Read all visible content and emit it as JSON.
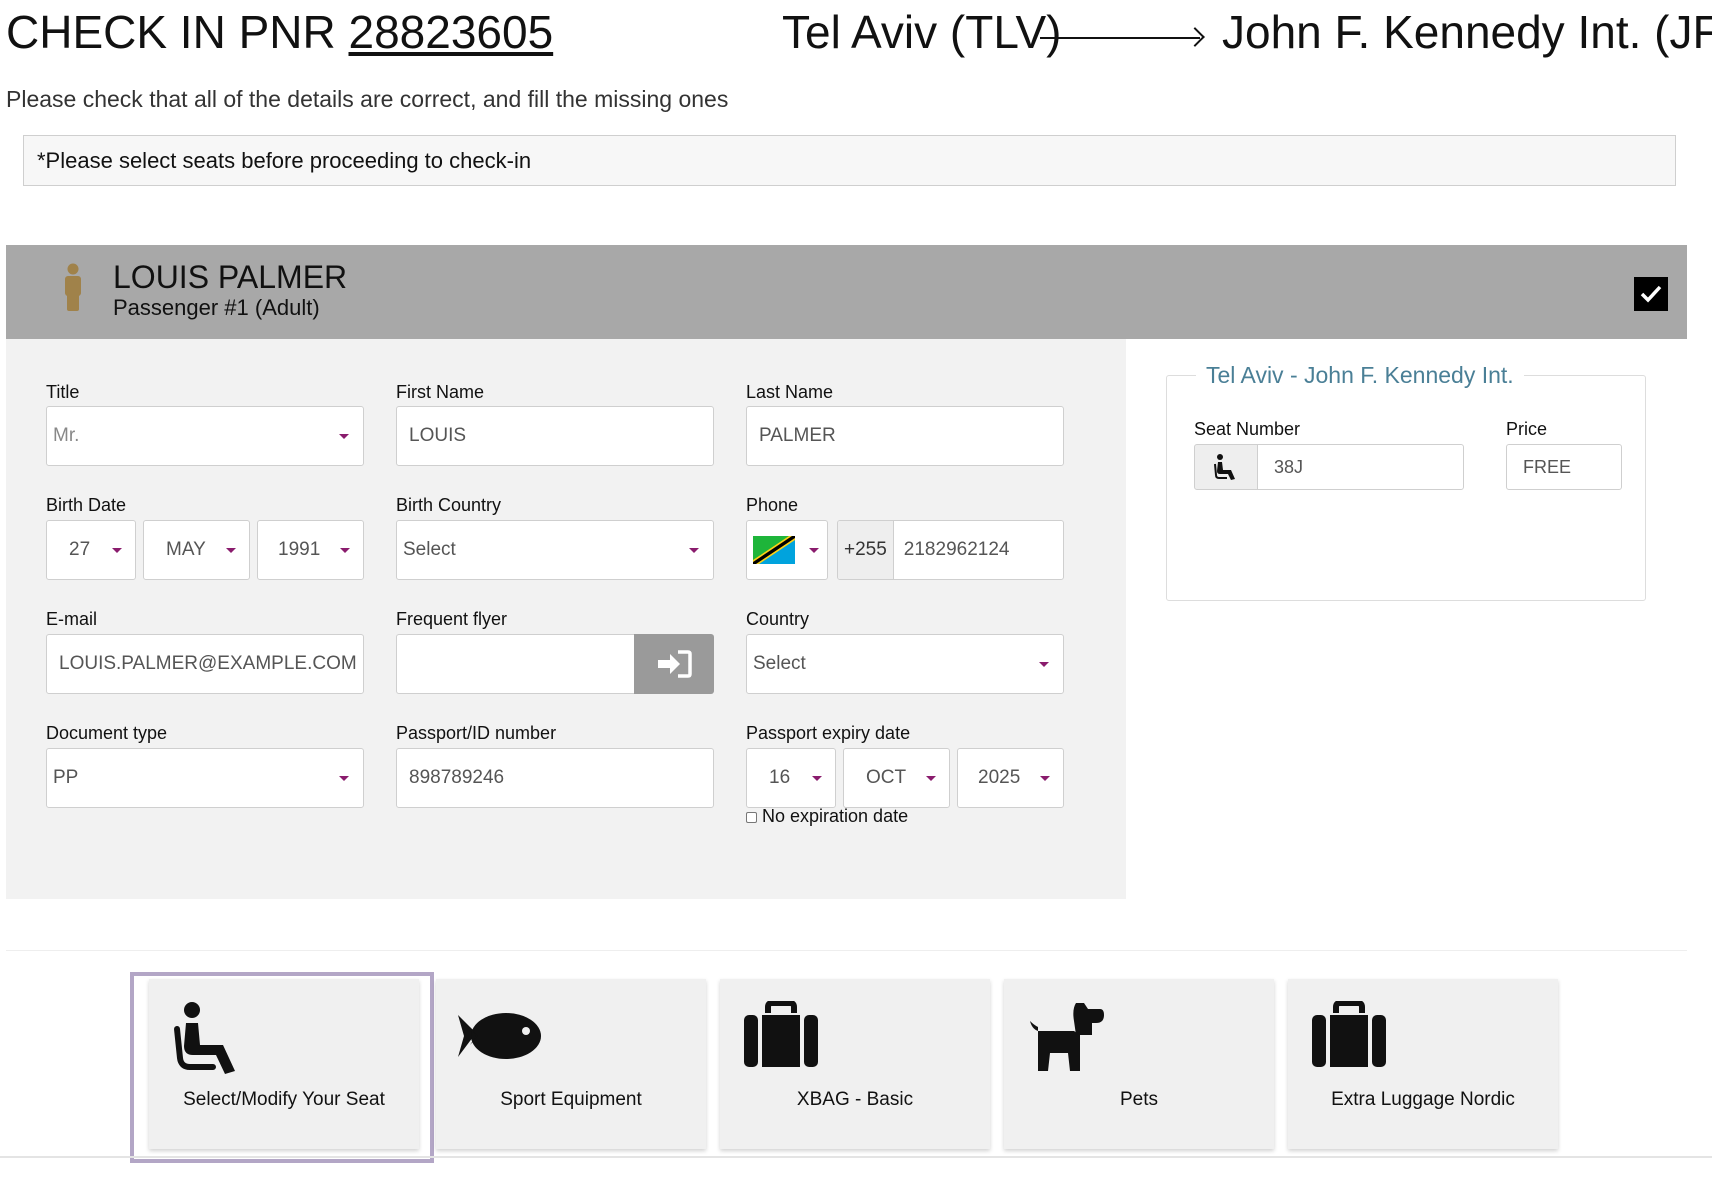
{
  "header": {
    "title_prefix": "CHECK IN PNR",
    "pnr": "28823605",
    "origin": "Tel Aviv (TLV)",
    "destination": "John F. Kennedy Int. (JFK)",
    "subtitle": "Please check that all of the details are correct, and fill the missing ones",
    "notice": "*Please select seats before proceeding to check-in"
  },
  "passenger": {
    "name": "LOUIS PALMER",
    "subtitle": "Passenger #1 (Adult)",
    "icon": "person-icon",
    "checked": true
  },
  "form": {
    "title": {
      "label": "Title",
      "value": "Mr."
    },
    "first_name": {
      "label": "First Name",
      "value": "LOUIS"
    },
    "last_name": {
      "label": "Last Name",
      "value": "PALMER"
    },
    "birth_date": {
      "label": "Birth Date",
      "day": "27",
      "month": "MAY",
      "year": "1991"
    },
    "birth_country": {
      "label": "Birth Country",
      "value": "Select"
    },
    "phone": {
      "label": "Phone",
      "prefix": "+255",
      "value": "2182962124",
      "flag_icon": "tanzania-flag-icon"
    },
    "email": {
      "label": "E-mail",
      "value": "LOUIS.PALMER@EXAMPLE.COM"
    },
    "frequent_flyer": {
      "label": "Frequent flyer",
      "value": ""
    },
    "country": {
      "label": "Country",
      "value": "Select"
    },
    "document_type": {
      "label": "Document type",
      "value": "PP"
    },
    "passport_number": {
      "label": "Passport/ID number",
      "value": "898789246"
    },
    "passport_expiry": {
      "label": "Passport expiry date",
      "day": "16",
      "month": "OCT",
      "year": "2025"
    },
    "no_expiration": {
      "label": "No expiration date",
      "checked": false
    }
  },
  "seat": {
    "legend": "Tel Aviv - John F. Kennedy Int.",
    "seat_label": "Seat Number",
    "seat_value": "38J",
    "price_label": "Price",
    "price_value": "FREE"
  },
  "services": [
    {
      "label": "Select/Modify Your Seat",
      "icon": "seat-icon",
      "selected": true
    },
    {
      "label": "Sport Equipment",
      "icon": "fish-icon"
    },
    {
      "label": "XBAG - Basic",
      "icon": "suitcase-icon"
    },
    {
      "label": "Pets",
      "icon": "dog-icon"
    },
    {
      "label": "Extra Luggage Nordic",
      "icon": "suitcase-icon"
    }
  ],
  "colors": {
    "passenger_bar": "#a8a8a8",
    "caret": "#8a1c6d",
    "seat_legend": "#4a7f96",
    "selected_tile_border": "#b3a6c6",
    "person_icon": "#a0824a"
  }
}
